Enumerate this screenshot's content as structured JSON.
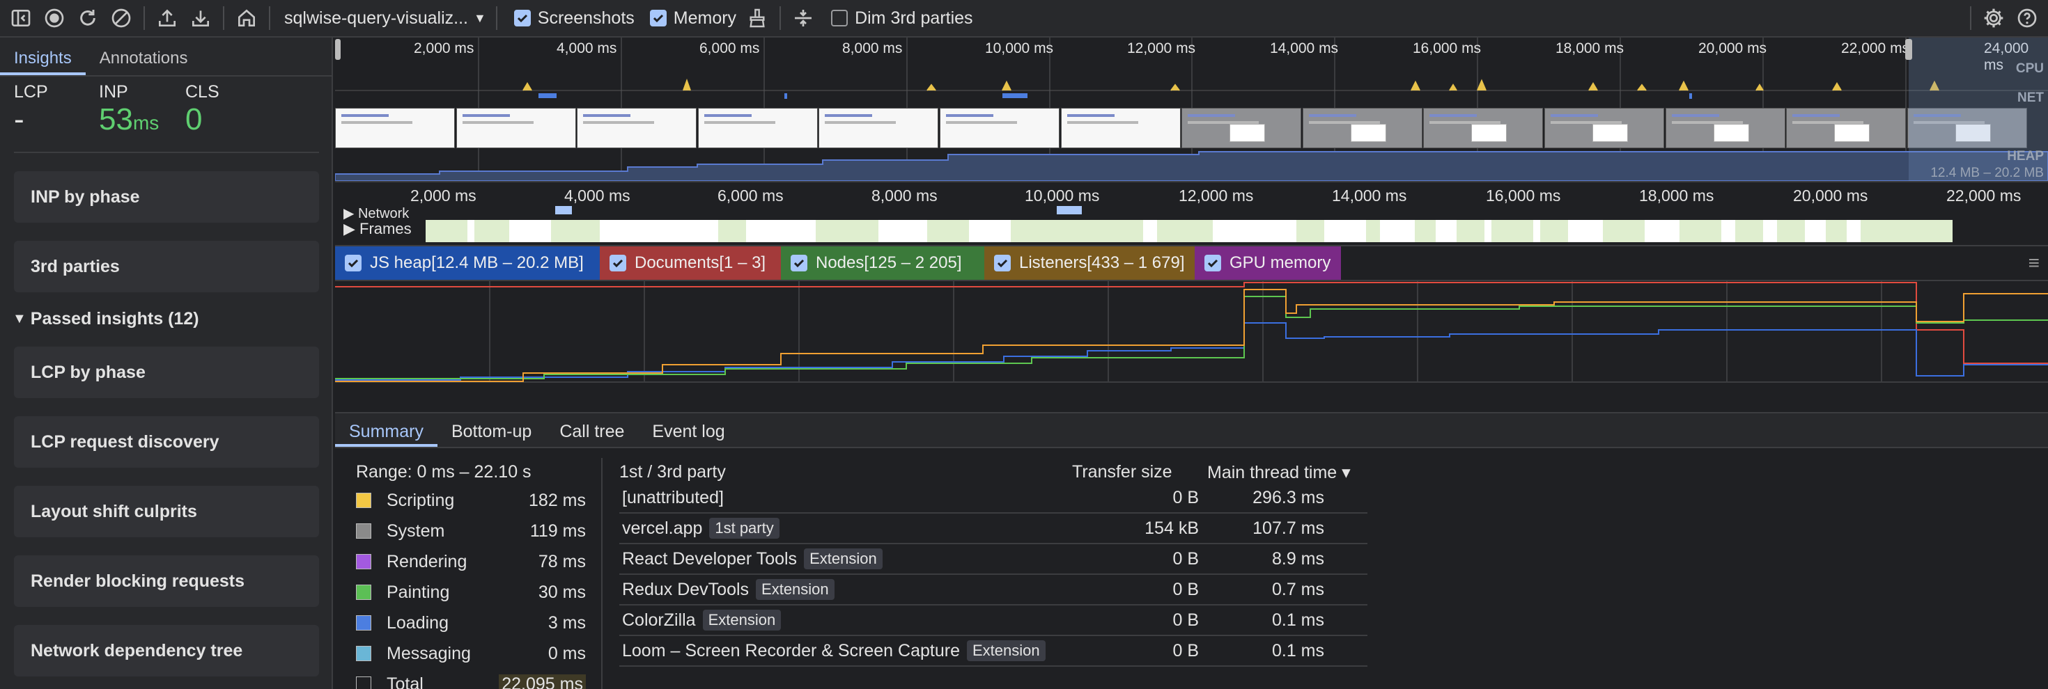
{
  "toolbar": {
    "icons": [
      "panel-toggle-icon",
      "record-icon",
      "reload-icon",
      "clear-icon",
      "upload-icon",
      "download-icon",
      "home-icon"
    ],
    "recording_select": "sqlwise-query-visualiz...",
    "screenshots_label": "Screenshots",
    "screenshots_checked": true,
    "memory_label": "Memory",
    "memory_checked": true,
    "dim_label": "Dim 3rd parties",
    "dim_checked": false,
    "right_icons": [
      "settings-icon",
      "help-icon"
    ]
  },
  "sidebar": {
    "tabs": [
      "Insights",
      "Annotations"
    ],
    "active_tab": "Insights",
    "metrics": [
      {
        "label": "LCP",
        "value": "-",
        "unit": ""
      },
      {
        "label": "INP",
        "value": "53",
        "unit": "ms"
      },
      {
        "label": "CLS",
        "value": "0",
        "unit": ""
      }
    ],
    "cards_top": [
      "INP by phase",
      "3rd parties"
    ],
    "passed_header": "Passed insights (12)",
    "cards_passed": [
      "LCP by phase",
      "LCP request discovery",
      "Layout shift culprits",
      "Render blocking requests",
      "Network dependency tree"
    ]
  },
  "overview": {
    "ticks": [
      "2,000 ms",
      "4,000 ms",
      "6,000 ms",
      "8,000 ms",
      "10,000 ms",
      "12,000 ms",
      "14,000 ms",
      "16,000 ms",
      "18,000 ms",
      "20,000 ms",
      "22,000 ms",
      "24,000 ms"
    ],
    "cpu_label": "CPU",
    "net_label": "NET",
    "heap_label": "HEAP",
    "heap_range": "12.4 MB – 20.2 MB"
  },
  "ruler": {
    "ticks": [
      "2,000 ms",
      "4,000 ms",
      "6,000 ms",
      "8,000 ms",
      "10,000 ms",
      "12,000 ms",
      "14,000 ms",
      "16,000 ms",
      "18,000 ms",
      "20,000 ms",
      "22,000 ms"
    ]
  },
  "tracks": {
    "network_label": "Network",
    "frames_label": "Frames"
  },
  "memory": {
    "counters": [
      {
        "label": "JS heap[12.4 MB – 20.2 MB]",
        "color": "#1e4fa8",
        "line": "#3b6fe0"
      },
      {
        "label": "Documents[1 – 3]",
        "color": "#a33a3a",
        "line": "#e04b3f"
      },
      {
        "label": "Nodes[125 – 2 205]",
        "color": "#3b7a3a",
        "line": "#5ec750"
      },
      {
        "label": "Listeners[433 – 1 679]",
        "color": "#7a5a1e",
        "line": "#f0a032"
      },
      {
        "label": "GPU memory",
        "color": "#7a2a86",
        "line": "#b157d4"
      }
    ]
  },
  "bottom": {
    "tabs": [
      "Summary",
      "Bottom-up",
      "Call tree",
      "Event log"
    ],
    "active_tab": "Summary",
    "range": "Range: 0 ms – 22.10 s",
    "categories": [
      {
        "name": "Scripting",
        "value": "182 ms",
        "color": "#f2c744"
      },
      {
        "name": "System",
        "value": "119 ms",
        "color": "#8a8a8a"
      },
      {
        "name": "Rendering",
        "value": "78 ms",
        "color": "#a35ae0"
      },
      {
        "name": "Painting",
        "value": "30 ms",
        "color": "#5cbf55"
      },
      {
        "name": "Loading",
        "value": "3 ms",
        "color": "#4c7ee0"
      },
      {
        "name": "Messaging",
        "value": "0 ms",
        "color": "#6ab6d6"
      },
      {
        "name": "Total",
        "value": "22,095 ms",
        "color": "transparent"
      }
    ],
    "table": {
      "col_party": "1st / 3rd party",
      "col_transfer": "Transfer size",
      "col_main": "Main thread time ▾",
      "rows": [
        {
          "name": "[unattributed]",
          "badge": "",
          "transfer": "0 B",
          "main": "296.3 ms"
        },
        {
          "name": "vercel.app",
          "badge": "1st party",
          "transfer": "154 kB",
          "main": "107.7 ms"
        },
        {
          "name": "React Developer Tools",
          "badge": "Extension",
          "transfer": "0 B",
          "main": "8.9 ms"
        },
        {
          "name": "Redux DevTools",
          "badge": "Extension",
          "transfer": "0 B",
          "main": "0.7 ms"
        },
        {
          "name": "ColorZilla",
          "badge": "Extension",
          "transfer": "0 B",
          "main": "0.1 ms"
        },
        {
          "name": "Loom – Screen Recorder & Screen Capture",
          "badge": "Extension",
          "transfer": "0 B",
          "main": "0.1 ms"
        }
      ]
    }
  }
}
